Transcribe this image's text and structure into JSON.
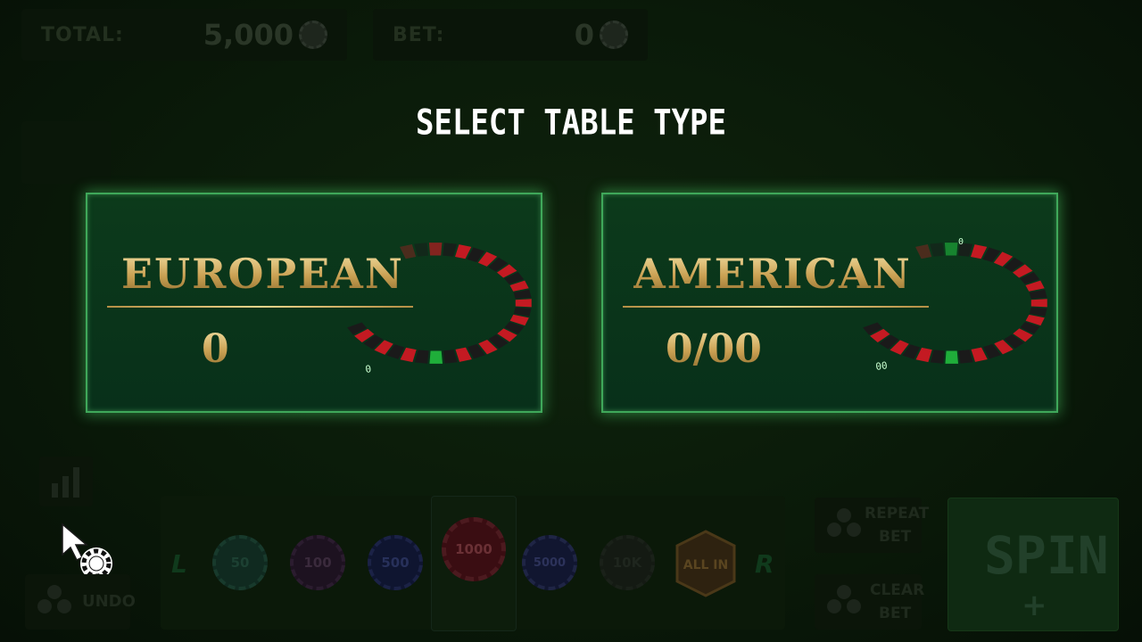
{
  "top": {
    "total_label": "TOTAL:",
    "total_value": "5,000",
    "bet_label": "BET:",
    "bet_value": "0"
  },
  "dialog": {
    "title": "SELECT TABLE TYPE",
    "options": [
      {
        "name": "EUROPEAN",
        "sub": "0",
        "pocket": "0"
      },
      {
        "name": "AMERICAN",
        "sub": "0/00",
        "pocket_a": "0",
        "pocket_b": "00"
      }
    ]
  },
  "controls": {
    "undo_label": "UNDO",
    "left_marker": "L",
    "right_marker": "R",
    "chips": [
      "50",
      "100",
      "500",
      "1000",
      "5000",
      "10K",
      "ALL IN"
    ],
    "repeat_bet_line1": "REPEAT",
    "repeat_bet_line2": "BET",
    "clear_bet_line1": "CLEAR",
    "clear_bet_line2": "BET",
    "spin_label": "SPIN",
    "spin_plus": "+"
  },
  "colors": {
    "panel_border": "#3fa85a",
    "gold": "#d6b46b",
    "wheel_red": "#c41a22",
    "wheel_black": "#1a1a1a",
    "wheel_green": "#1fae3a"
  }
}
